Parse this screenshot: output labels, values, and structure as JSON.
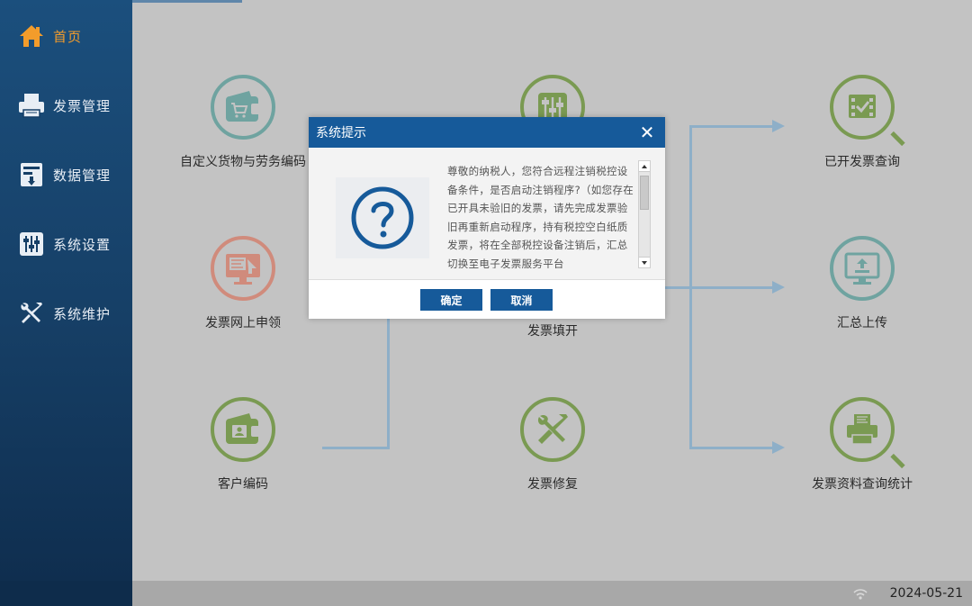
{
  "sidebar": {
    "items": [
      {
        "label": "首页",
        "icon": "home-icon",
        "active": true
      },
      {
        "label": "发票管理",
        "icon": "printer-icon",
        "active": false
      },
      {
        "label": "数据管理",
        "icon": "database-icon",
        "active": false
      },
      {
        "label": "系统设置",
        "icon": "sliders-icon",
        "active": false
      },
      {
        "label": "系统维护",
        "icon": "tools-icon",
        "active": false
      }
    ]
  },
  "functions": {
    "custom_goods": {
      "label": "自定义货物与劳务编码",
      "icon": "wallet-cart-icon",
      "color": "#6fa3a0"
    },
    "invoice_apply": {
      "label": "发票网上申领",
      "icon": "monitor-invoice-icon",
      "color": "#d08b7c"
    },
    "customer_code": {
      "label": "客户编码",
      "icon": "wallet-card-icon",
      "color": "#7a9a52"
    },
    "invoice_fill": {
      "label": "发票填开",
      "icon": "sliders-icon",
      "color": "#7a9a52"
    },
    "invoice_repair": {
      "label": "发票修复",
      "icon": "tools-icon",
      "color": "#7a9a52"
    },
    "issued_query": {
      "label": "已开发票查询",
      "icon": "search-check-icon",
      "color": "#7a9a52"
    },
    "summary_upload": {
      "label": "汇总上传",
      "icon": "monitor-upload-icon",
      "color": "#6fa3a0"
    },
    "data_stats": {
      "label": "发票资料查询统计",
      "icon": "search-printer-icon",
      "color": "#7a9a52"
    }
  },
  "dialog": {
    "title": "系统提示",
    "close_symbol": "✕",
    "message": "尊敬的纳税人，您符合远程注销税控设备条件，是否启动注销程序?（如您存在已开具未验旧的发票，请先完成发票验旧再重新启动程序，持有税控空白纸质发票，将在全部税控设备注销后，汇总切换至电子发票服务平台",
    "ok_label": "确定",
    "cancel_label": "取消"
  },
  "statusbar": {
    "date": "2024-05-21"
  },
  "colors": {
    "sidebar": "#163f66",
    "accent": "#165a9a",
    "active": "#f39c2b",
    "flow_line": "#8eafc8"
  }
}
